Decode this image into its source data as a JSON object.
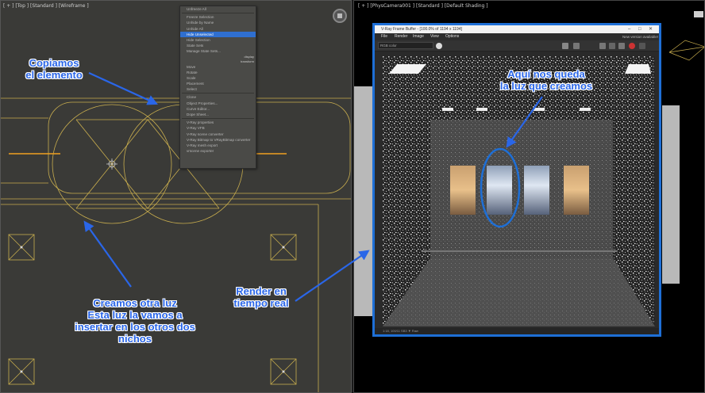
{
  "viewports": {
    "left_label": "[ + ] [Top ] [Standard ] [Wireframe ]",
    "right_label": "[ + ] [PhysCamera001 ] [Standard ] [Default Shading ]"
  },
  "context_menu": {
    "items": [
      "Unfreeze All",
      "Freeze Selection",
      "Unhide by Name",
      "Unhide All",
      "Hide Unselected",
      "Hide Selection",
      "State Sets",
      "Manage State Sets...",
      "",
      "Move",
      "Rotate",
      "Scale",
      "Placement",
      "Select",
      "",
      "Clone",
      "Object Properties...",
      "Curve Editor...",
      "Dope Sheet...",
      "",
      "V-Ray properties",
      "V-Ray VFB",
      "V-Ray scene converter",
      "V-Ray Bitmap to VRayBitmap converter",
      "V-Ray mesh export",
      "vrscene exporter"
    ],
    "highlighted_index": 4,
    "right_labels": [
      "display",
      "transform"
    ]
  },
  "vfb": {
    "title": "V-Ray Frame Buffer - [100.0% of 1194 x 1194]",
    "menu": [
      "File",
      "Render",
      "Image",
      "View",
      "Options"
    ],
    "new_version": "New version available!",
    "channel": "RGB color",
    "status": "1:18, 100/11   SB3  ▼   Raw"
  },
  "annotations": {
    "copy_element": [
      "Copiamos",
      "el elemento"
    ],
    "create_light": [
      "Creamos otra luz",
      "Esta luz la vamos a",
      "insertar en los otros dos",
      "nichos"
    ],
    "realtime_render": [
      "Render en",
      "tiempo real"
    ],
    "light_remains": [
      "Aquí nos queda",
      "la luz que creamos"
    ]
  },
  "colors": {
    "annotation_blue": "#2a66e8",
    "selection_blue": "#1e6fd6",
    "wire_yellow": "#d0b24a",
    "light_orange": "#f0a020"
  }
}
